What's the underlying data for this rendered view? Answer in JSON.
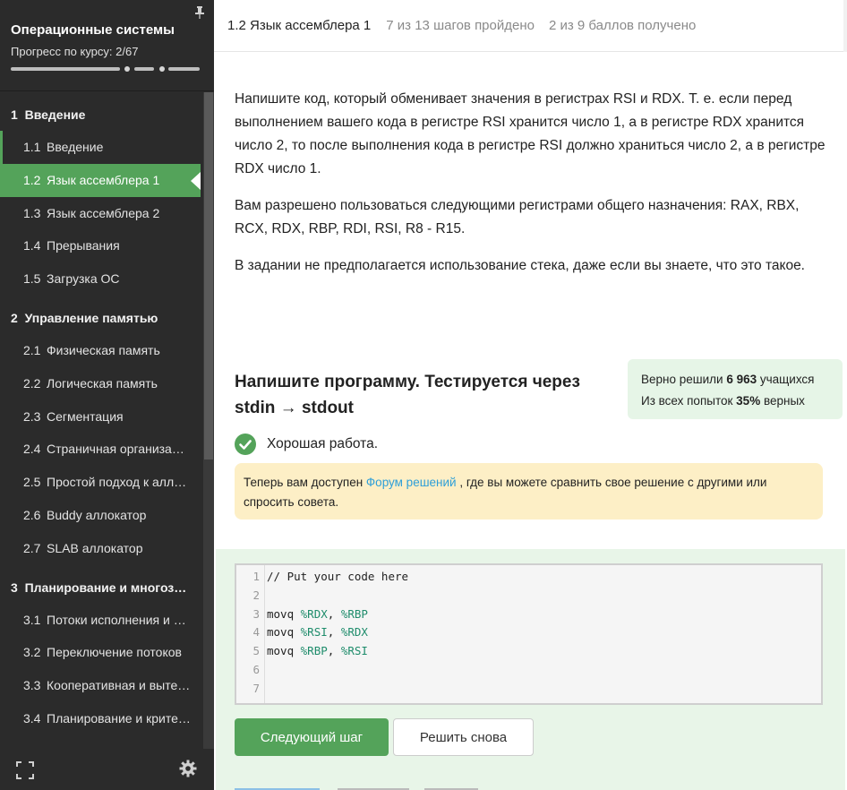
{
  "sidebar": {
    "course_title": "Операционные системы",
    "progress_label": "Прогресс по курсу:",
    "progress_value": "2/67",
    "sections": [
      {
        "num": "1",
        "title": "Введение",
        "lessons": [
          {
            "num": "1.1",
            "title": "Введение"
          },
          {
            "num": "1.2",
            "title": "Язык ассемблера 1"
          },
          {
            "num": "1.3",
            "title": "Язык ассемблера 2"
          },
          {
            "num": "1.4",
            "title": "Прерывания"
          },
          {
            "num": "1.5",
            "title": "Загрузка ОС"
          }
        ]
      },
      {
        "num": "2",
        "title": "Управление памятью",
        "lessons": [
          {
            "num": "2.1",
            "title": "Физическая память"
          },
          {
            "num": "2.2",
            "title": "Логическая память"
          },
          {
            "num": "2.3",
            "title": "Сегментация"
          },
          {
            "num": "2.4",
            "title": "Страничная организа…"
          },
          {
            "num": "2.5",
            "title": "Простой подход к алл…"
          },
          {
            "num": "2.6",
            "title": "Buddy аллокатор"
          },
          {
            "num": "2.7",
            "title": "SLAB аллокатор"
          }
        ]
      },
      {
        "num": "3",
        "title": "Планирование и многоз…",
        "lessons": [
          {
            "num": "3.1",
            "title": "Потоки исполнения и …"
          },
          {
            "num": "3.2",
            "title": "Переключение потоков"
          },
          {
            "num": "3.3",
            "title": "Кооперативная и выте…"
          },
          {
            "num": "3.4",
            "title": "Планирование и крите…"
          }
        ]
      }
    ]
  },
  "topbar": {
    "lesson_title": "1.2 Язык ассемблера 1",
    "steps": "7 из 13 шагов пройдено",
    "points": "2 из 9 баллов  получено"
  },
  "task": {
    "p1": "Напишите код, который обменивает значения в регистрах RSI и RDX. Т. е. если перед выполнением вашего кода в регистре RSI хранится число 1, а в регистре RDX хранится число 2, то после выполнения кода в регистре RSI должно храниться число 2, а в регистре RDX число 1.",
    "p2": "Вам разрешено пользоваться следующими регистрами общего назначения: RAX, RBX, RCX, RDX, RBP, RDI, RSI, R8 - R15.",
    "p3": "В задании не предполагается использование стека, даже если вы знаете, что это такое."
  },
  "exercise": {
    "heading": "Напишите программу. Тестируется через stdin → stdout",
    "stats_solved_prefix": "Верно решили",
    "stats_solved_count": "6 963",
    "stats_solved_suffix": "учащихся",
    "stats_attempts_prefix": "Из всех попыток",
    "stats_attempts_pct": "35%",
    "stats_attempts_suffix": "верных",
    "result": "Хорошая работа.",
    "notice_before": "Теперь вам доступен ",
    "notice_link": "Форум решений",
    "notice_after": " , где вы можете сравнить свое решение с другими или спросить совета."
  },
  "editor": {
    "line_numbers": [
      "1",
      "2",
      "3",
      "4",
      "5",
      "6",
      "7"
    ],
    "comment": "// Put your code here",
    "instr": "movq",
    "l3_a": "%RDX",
    "l3_b": "%RBP",
    "l4_a": "%RSI",
    "l4_b": "%RDX",
    "l5_a": "%RBP",
    "l5_b": "%RSI"
  },
  "buttons": {
    "next": "Следующий шаг",
    "retry": "Решить снова"
  },
  "colors": {
    "accent_green": "#54a35a",
    "sidebar_bg": "#2b2b2b",
    "notice_bg": "#fdefc6",
    "link": "#2e9fd8"
  }
}
